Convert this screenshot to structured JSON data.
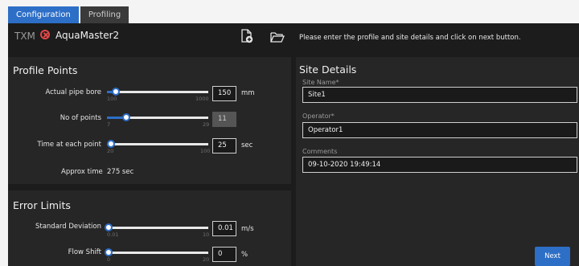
{
  "tabs": [
    {
      "label": "Configuration",
      "active": true
    },
    {
      "label": "Profiling",
      "active": false
    }
  ],
  "header": {
    "brand": "TXM",
    "status_icon": "error-circle-icon",
    "device_name": "AquaMaster2",
    "new_file_icon": "new-file-icon",
    "open_folder_icon": "open-folder-icon",
    "instruction": "Please enter the profile and site details and click on next button."
  },
  "profile_points": {
    "title": "Profile Points",
    "rows": [
      {
        "label": "Actual pipe bore",
        "min": "100",
        "max": "1000",
        "value": "150",
        "unit": "mm",
        "fraction": 0.06,
        "disabled": false
      },
      {
        "label": "No of points",
        "min": "7",
        "max": "29",
        "value": "11",
        "unit": "",
        "fraction": 0.18,
        "disabled": true
      },
      {
        "label": "Time at each point",
        "min": "20",
        "max": "100",
        "value": "25",
        "unit": "sec",
        "fraction": 0.06,
        "disabled": false
      }
    ],
    "approx_label": "Approx time",
    "approx_value": "275 sec"
  },
  "error_limits": {
    "title": "Error Limits",
    "rows": [
      {
        "label": "Standard Deviation",
        "min": "0.01",
        "max": "10",
        "value": "0.01",
        "unit": "m/s",
        "fraction": 0.0
      },
      {
        "label": "Flow Shift",
        "min": "0",
        "max": "20",
        "value": "0",
        "unit": "%",
        "fraction": 0.0
      }
    ]
  },
  "site_details": {
    "title": "Site Details",
    "fields": [
      {
        "label": "Site Name*",
        "value": "Site1"
      },
      {
        "label": "Operator*",
        "value": "Operator1"
      },
      {
        "label": "Comments",
        "value": "09-10-2020 19:49:14"
      }
    ]
  },
  "next_button": {
    "label": "Next"
  },
  "colors": {
    "accent": "#2d6ec7",
    "error": "#e04848",
    "panel": "#262626",
    "background": "#1c1c1c"
  }
}
